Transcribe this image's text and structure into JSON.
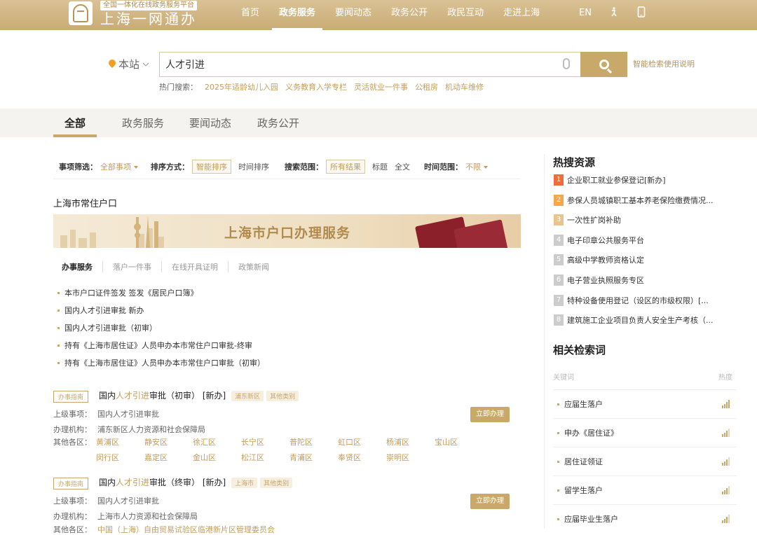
{
  "header": {
    "slogan": "全国一体化在线政务服务平台",
    "site_name": "上海一网通办",
    "nav": [
      "首页",
      "政务服务",
      "要闻动态",
      "政务公开",
      "政民互动",
      "走进上海"
    ],
    "nav_active": 1,
    "lang": "EN"
  },
  "search": {
    "scope": "本站",
    "query": "人才引进",
    "help": "智能检索使用说明",
    "hot_label": "热门搜索：",
    "hot_terms": [
      "2025年适龄幼儿入园",
      "义务教育入学专栏",
      "灵活就业一件事",
      "公租房",
      "机动车维修"
    ]
  },
  "tabs": [
    "全部",
    "政务服务",
    "要闻动态",
    "政务公开"
  ],
  "filters": {
    "item_label": "事项筛选：",
    "item_value": "全部事项",
    "sort_label": "排序方式：",
    "sort_active": "智能排序",
    "sort_other": "时间排序",
    "range_label": "搜索范围：",
    "range_active": "所有结果",
    "range_opt1": "标题",
    "range_opt2": "全文",
    "time_label": "时间范围：",
    "time_value": "不限"
  },
  "card": {
    "section_title": "上海市常住户口",
    "banner_title": "上海市户口办理服务",
    "subtabs": [
      "办事服务",
      "落户一件事",
      "在线开具证明",
      "政策新闻"
    ],
    "items": [
      "本市户口证件签发 签发《居民户口簿》",
      "国内人才引进审批 新办",
      "国内人才引进审批（初审）",
      "持有《上海市居住证》人员申办本市常住户口审批-终审",
      "持有《上海市居住证》人员申办本市常住户口审批（初审）"
    ]
  },
  "results": [
    {
      "badge": "办事指南",
      "title_pre": "国内",
      "title_hl": "人才引进",
      "title_post": "审批（初审）",
      "suffix": "[新办]",
      "tags": [
        "浦东新区",
        "其他类别"
      ],
      "parent_label": "上级事项：",
      "parent": "国内人才引进审批",
      "org_label": "办理机构：",
      "org": "浦东新区人力资源和社会保障局",
      "districts_label": "其他各区：",
      "districts": [
        "黄浦区",
        "静安区",
        "徐汇区",
        "长宁区",
        "普陀区",
        "虹口区",
        "杨浦区",
        "宝山区",
        "闵行区",
        "嘉定区",
        "金山区",
        "松江区",
        "青浦区",
        "奉贤区",
        "崇明区"
      ],
      "apply": "立即办理"
    },
    {
      "badge": "办事指南",
      "title_pre": "国内",
      "title_hl": "人才引进",
      "title_post": "审批（终审）",
      "suffix": "[新办]",
      "tags": [
        "上海市",
        "其他类别"
      ],
      "parent_label": "上级事项：",
      "parent": "国内人才引进审批",
      "org_label": "办理机构：",
      "org": "上海市人力资源和社会保障局",
      "districts_label": "其他各区：",
      "districts_partial": "中国（上海）自由贸易试验区临港新片区管理委员会",
      "apply": "立即办理"
    }
  ],
  "sidebar": {
    "hot_title": "热搜资源",
    "hot_items": [
      "企业职工就业参保登记[新办]",
      "参保人员城镇职工基本养老保险缴费情况...",
      "一次性扩岗补助",
      "电子印章公共服务平台",
      "高级中学教师资格认定",
      "电子营业执照服务专区",
      "特种设备使用登记（设区的市级权限）[...",
      "建筑施工企业项目负责人安全生产考核（..."
    ],
    "related_title": "相关检索词",
    "kw_head_left": "关键词",
    "kw_head_right": "热度",
    "keywords": [
      "应届生落户",
      "申办《居住证》",
      "居住证领证",
      "留学生落户",
      "应届毕业生落户"
    ]
  }
}
